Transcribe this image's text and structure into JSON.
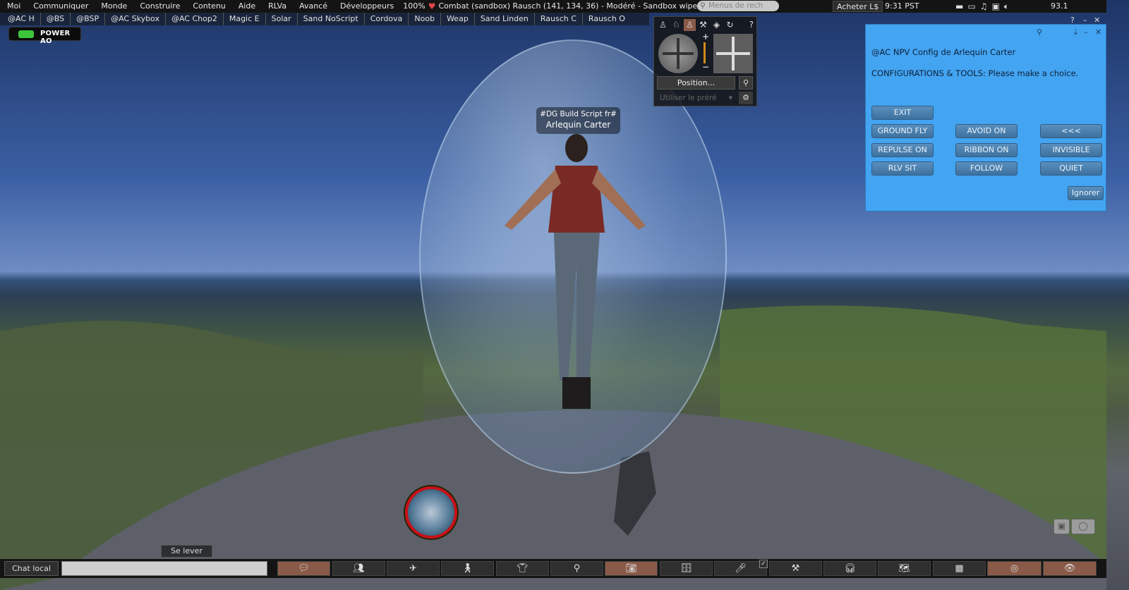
{
  "menubar": {
    "items": [
      "Moi",
      "Communiquer",
      "Monde",
      "Construire",
      "Contenu",
      "Aide",
      "RLVa",
      "Avancé",
      "Développeurs"
    ],
    "volume": "100%",
    "location": "Combat (sandbox) Rausch (141, 134, 36) - Modéré - Sandbox wipe",
    "search_placeholder": "Menus de rech",
    "buy_label": "Acheter L$",
    "time": "9:31",
    "timezone": "PST",
    "fps": "93.1"
  },
  "favorites": [
    "@AC H",
    "@BS",
    "@BSP",
    "@AC Skybox",
    "@AC Chop2",
    "Magic E",
    "Solar",
    "Sand NoScript",
    "Cordova",
    "Noob",
    "Weap",
    "Sand Linden",
    "Rausch C",
    "Rausch O"
  ],
  "hud": {
    "ao_label": "POWER AO"
  },
  "nametag": {
    "group": "#DG Build Script fr#",
    "name": "Arlequin Carter"
  },
  "camera_panel": {
    "position_label": "Position...",
    "preset_placeholder": "Utiliser le préré"
  },
  "dialog": {
    "title": "@AC NPV Config de Arlequin Carter",
    "message": "CONFIGURATIONS & TOOLS: Please make a choice.",
    "buttons": [
      "EXIT",
      "GROUND FLY",
      "AVOID ON",
      "<<<",
      "REPULSE ON",
      "RIBBON ON",
      "INVISIBLE",
      "RLV SIT",
      "FOLLOW",
      "QUIET"
    ],
    "ignore_label": "Ignorer"
  },
  "bottom": {
    "stand_label": "Se lever",
    "chat_label": "Chat local",
    "chat_value": ""
  },
  "colors": {
    "dialog_bg": "#43a4f2",
    "active_button": "#8a5a48",
    "orb_ring": "#c8101a"
  }
}
